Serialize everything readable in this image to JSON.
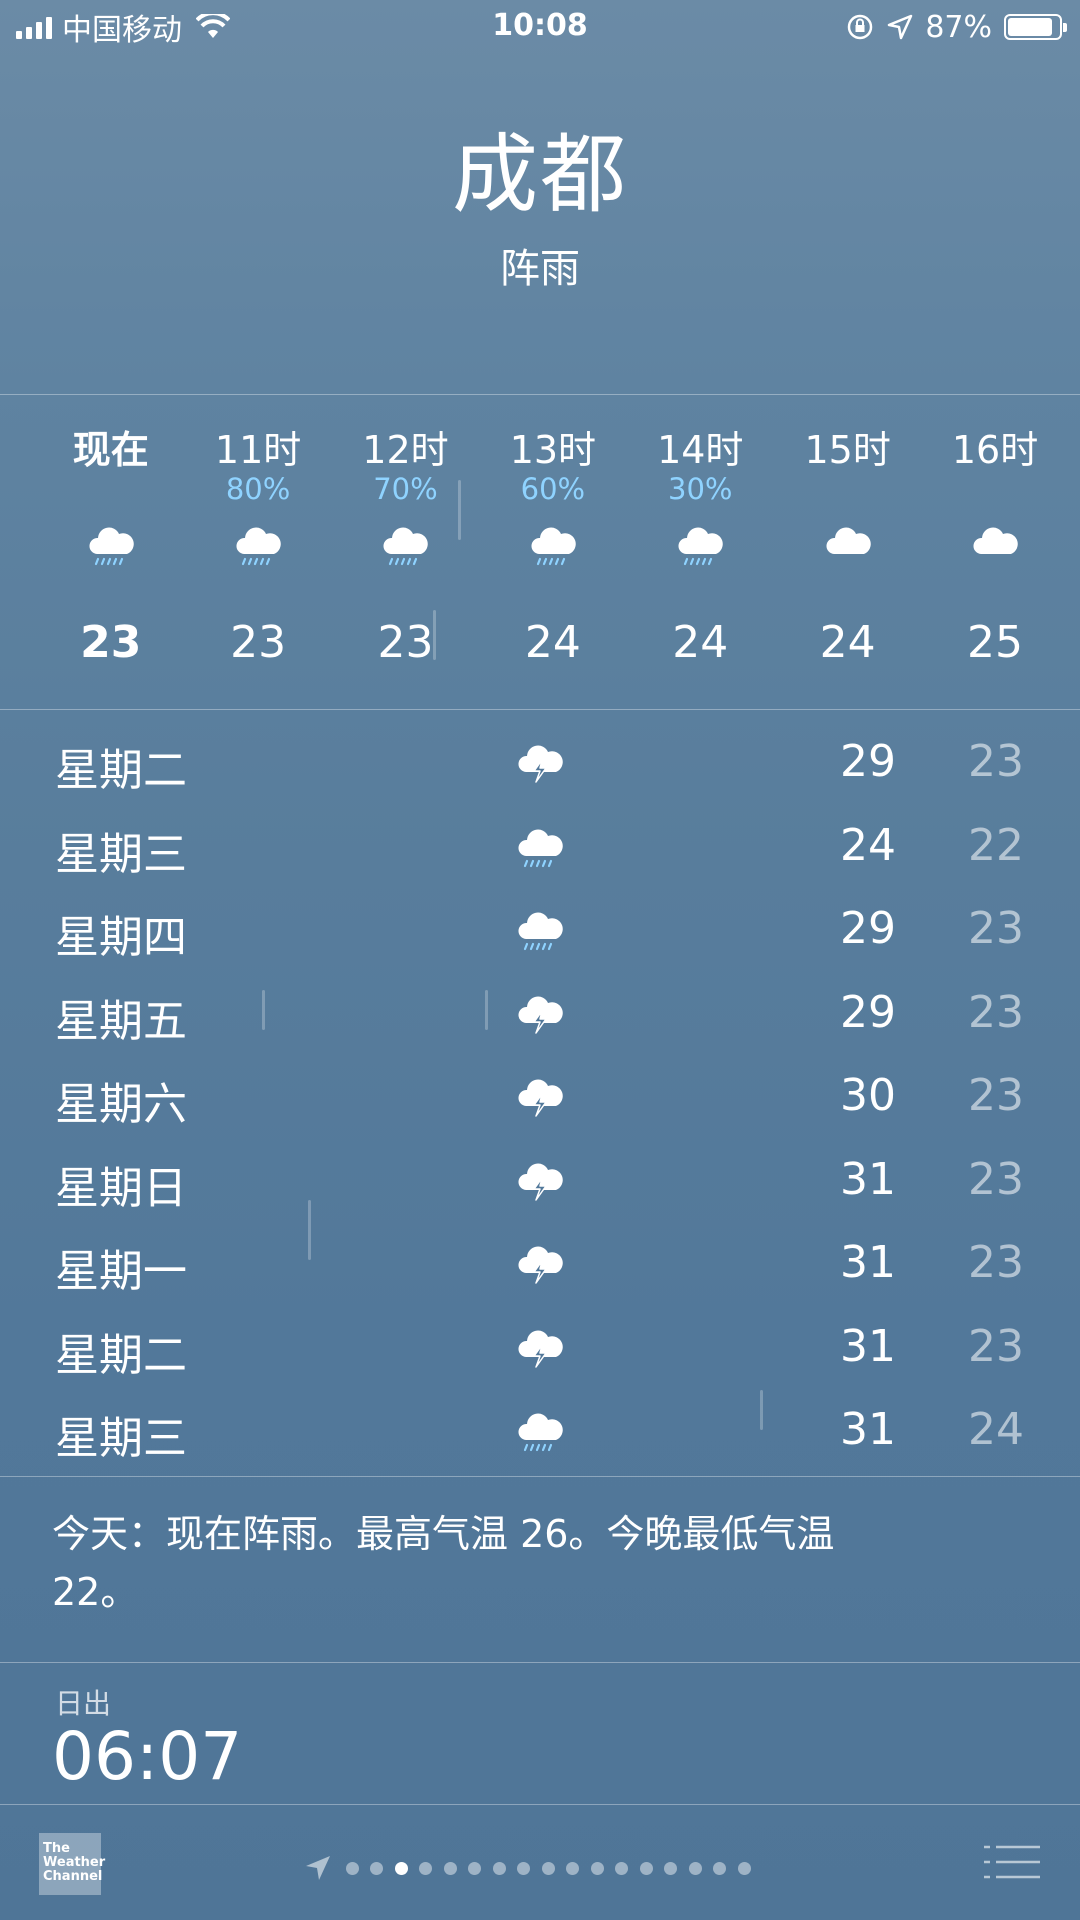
{
  "status_bar": {
    "carrier": "中国移动",
    "time": "10:08",
    "battery_percent": "87%",
    "battery_level": 0.87,
    "icons": [
      "signal-icon",
      "wifi-icon",
      "orientation-lock-icon",
      "location-arrow-icon",
      "battery-icon"
    ]
  },
  "header": {
    "city": "成都",
    "condition": "阵雨"
  },
  "hourly": [
    {
      "time": "现在",
      "precip": "",
      "icon": "cloud-rain-icon",
      "temp": "23",
      "is_now": true
    },
    {
      "time": "11时",
      "precip": "80%",
      "icon": "cloud-rain-icon",
      "temp": "23"
    },
    {
      "time": "12时",
      "precip": "70%",
      "icon": "cloud-rain-icon",
      "temp": "23"
    },
    {
      "time": "13时",
      "precip": "60%",
      "icon": "cloud-rain-icon",
      "temp": "24"
    },
    {
      "time": "14时",
      "precip": "30%",
      "icon": "cloud-rain-icon",
      "temp": "24"
    },
    {
      "time": "15时",
      "precip": "",
      "icon": "cloud-icon",
      "temp": "24"
    },
    {
      "time": "16时",
      "precip": "",
      "icon": "cloud-icon",
      "temp": "25"
    }
  ],
  "daily": [
    {
      "day": "星期二",
      "icon": "thunderstorm-icon",
      "high": "29",
      "low": "23"
    },
    {
      "day": "星期三",
      "icon": "cloud-rain-icon",
      "high": "24",
      "low": "22"
    },
    {
      "day": "星期四",
      "icon": "cloud-rain-icon",
      "high": "29",
      "low": "23"
    },
    {
      "day": "星期五",
      "icon": "thunderstorm-icon",
      "high": "29",
      "low": "23"
    },
    {
      "day": "星期六",
      "icon": "thunderstorm-icon",
      "high": "30",
      "low": "23"
    },
    {
      "day": "星期日",
      "icon": "thunderstorm-icon",
      "high": "31",
      "low": "23"
    },
    {
      "day": "星期一",
      "icon": "thunderstorm-icon",
      "high": "31",
      "low": "23"
    },
    {
      "day": "星期二",
      "icon": "thunderstorm-icon",
      "high": "31",
      "low": "23"
    },
    {
      "day": "星期三",
      "icon": "cloud-rain-icon",
      "high": "31",
      "low": "24"
    }
  ],
  "summary": {
    "text": "今天：现在阵雨。最高气温 26。今晚最低气温 22。"
  },
  "details": {
    "label": "日出",
    "value": "06:07"
  },
  "bottom_bar": {
    "logo_text": "The Weather Channel",
    "page_count": 17,
    "active_page": 2
  },
  "colors": {
    "precip_text": "#8fd3ff",
    "background_top": "#6b8ba6",
    "background_bottom": "#4f7597"
  }
}
